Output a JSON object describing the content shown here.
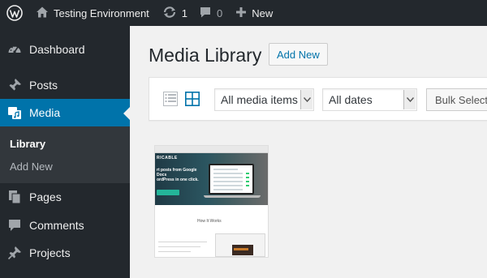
{
  "adminbar": {
    "site_name": "Testing Environment",
    "updates_count": "1",
    "comments_count": "0",
    "new_label": "New"
  },
  "sidebar": {
    "items": [
      {
        "label": "Dashboard",
        "icon": "dashboard-icon"
      },
      {
        "label": "Posts",
        "icon": "pin-icon"
      },
      {
        "label": "Media",
        "icon": "media-icon",
        "active": true
      },
      {
        "label": "Pages",
        "icon": "pages-icon"
      },
      {
        "label": "Comments",
        "icon": "comment-icon"
      },
      {
        "label": "Projects",
        "icon": "pin-icon"
      }
    ],
    "submenu": [
      {
        "label": "Library",
        "current": true
      },
      {
        "label": "Add New"
      }
    ]
  },
  "main": {
    "title": "Media Library",
    "add_new_label": "Add New",
    "toolbar": {
      "media_filter": "All media items",
      "date_filter": "All dates",
      "bulk_select_label": "Bulk Select"
    },
    "thumbnail": {
      "logo_text": "RICABLE",
      "headline": "rt posts from Google Docs\nordPress in one click.",
      "section_heading": "How It Works"
    }
  },
  "colors": {
    "adminbar_bg": "#23282d",
    "sidebar_bg": "#23282d",
    "active_menu_bg": "#0073aa",
    "submenu_bg": "#32373c",
    "link_blue": "#0073aa",
    "content_bg": "#f1f1f1"
  }
}
